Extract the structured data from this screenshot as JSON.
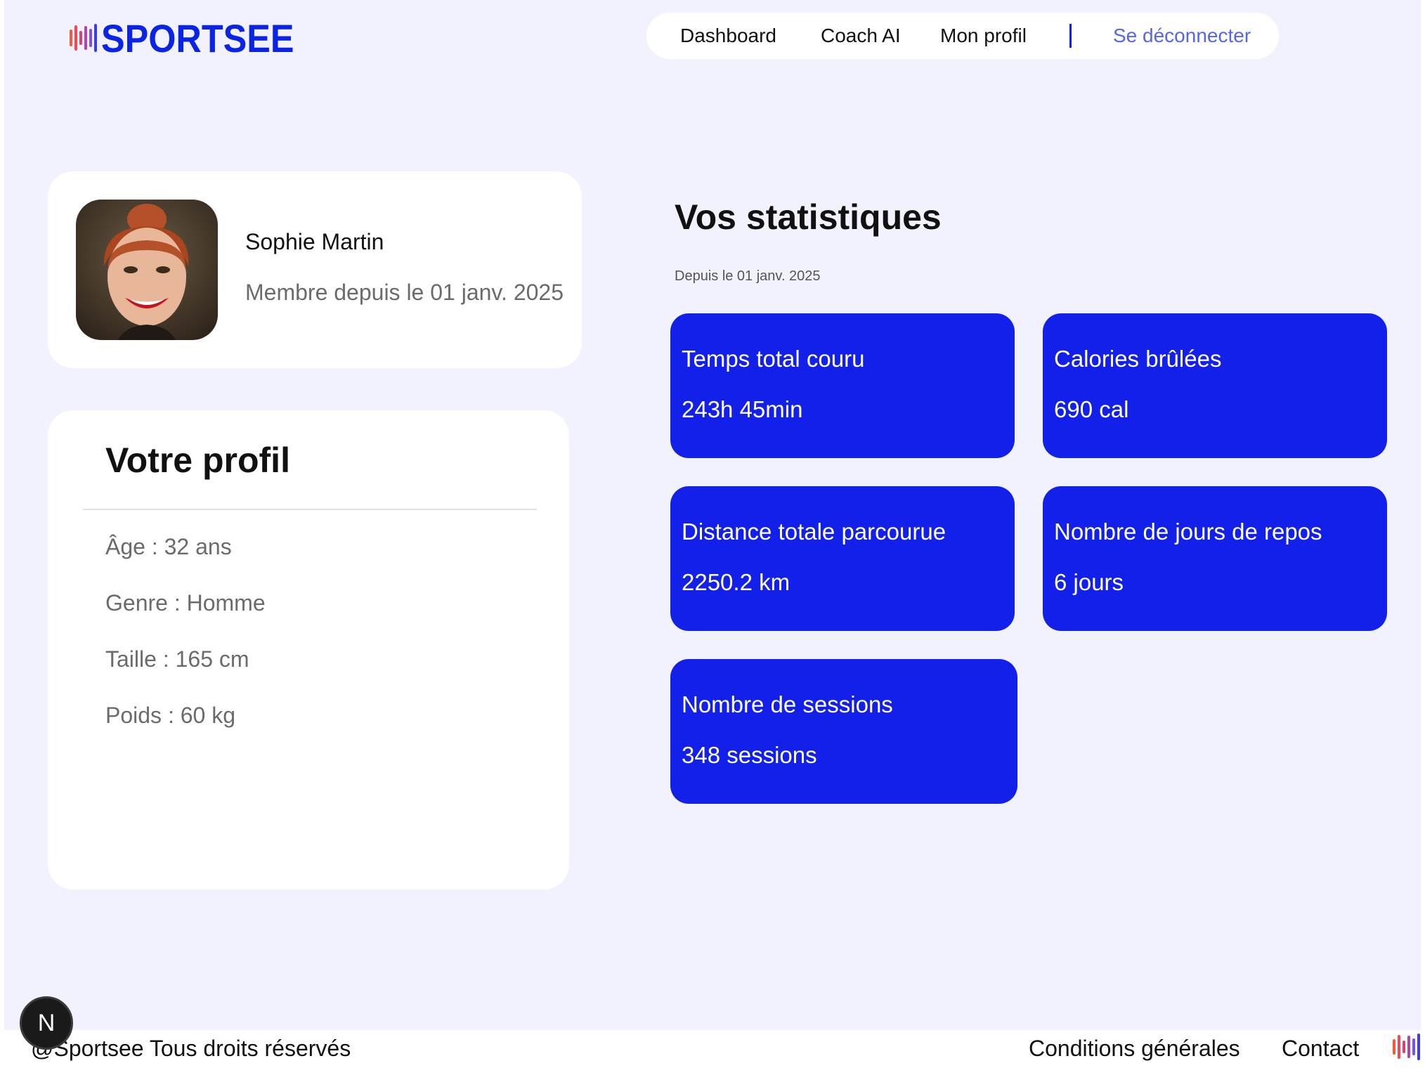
{
  "brand": {
    "name": "SPORTSEE",
    "color": "#0b23e6",
    "bar_gradient": [
      "#f15a3a",
      "#e0407a",
      "#7a50e6",
      "#1a2ef0"
    ]
  },
  "nav": {
    "dashboard": "Dashboard",
    "coach": "Coach AI",
    "profile": "Mon profil",
    "logout": "Se déconnecter"
  },
  "user": {
    "name": "Sophie Martin",
    "member_since": "Membre depuis le 01 janv. 2025"
  },
  "profile": {
    "title": "Votre profil",
    "age": "Âge : 32 ans",
    "gender": "Genre : Homme",
    "height": "Taille : 165 cm",
    "weight": "Poids : 60 kg"
  },
  "stats": {
    "title": "Vos statistiques",
    "since": "Depuis le 01 janv. 2025",
    "accent": "#1220ea",
    "items": [
      {
        "label": "Temps total couru",
        "value": "243h 45min"
      },
      {
        "label": "Calories brûlées",
        "value": "690 cal"
      },
      {
        "label": "Distance totale parcourue",
        "value": "2250.2 km"
      },
      {
        "label": "Nombre de jours de repos",
        "value": "6 jours"
      },
      {
        "label": "Nombre de sessions",
        "value": "348 sessions"
      }
    ]
  },
  "footer": {
    "copyright": "@Sportsee Tous droits réservés",
    "terms": "Conditions générales",
    "contact": "Contact"
  },
  "dev_badge": "N"
}
